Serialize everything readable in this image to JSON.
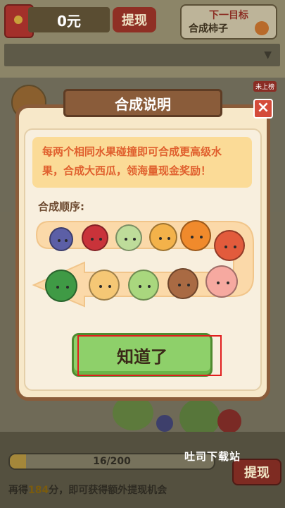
{
  "top_bar": {
    "money": "0元",
    "withdraw_label": "提现",
    "next_target_title": "下一目标",
    "next_target_name": "合成柿子",
    "dropdown_caret": "▼",
    "new_badge": "未上榜"
  },
  "modal": {
    "title": "合成说明",
    "close_label": "×",
    "description": "每两个相同水果碰撞即可合成更高级水果，合成大西瓜，领海量现金奖励！",
    "order_label": "合成顺序:",
    "confirm_label": "知道了",
    "fruits": [
      {
        "name": "葡萄",
        "color": "#5c5fa6"
      },
      {
        "name": "樱桃",
        "color": "#c9333a"
      },
      {
        "name": "橘子",
        "color": "#bedc9a"
      },
      {
        "name": "香蕉",
        "color": "#f3b24a"
      },
      {
        "name": "柿子",
        "color": "#f08a2c"
      },
      {
        "name": "番茄",
        "color": "#e25b3c"
      },
      {
        "name": "桃子",
        "color": "#f6a9a0"
      },
      {
        "name": "椰子",
        "color": "#a96a43"
      },
      {
        "name": "甜瓜",
        "color": "#a9d77e"
      },
      {
        "name": "菠萝",
        "color": "#f5c775"
      },
      {
        "name": "西瓜",
        "color": "#3f9a45"
      }
    ]
  },
  "bottom": {
    "progress_text": "16/200",
    "progress_fraction": 0.08,
    "withdraw_label": "提现",
    "hint_prefix": "再得",
    "hint_number": "184",
    "hint_suffix": "分，即可获得额外提现机会"
  },
  "watermark": "吐司下载站"
}
